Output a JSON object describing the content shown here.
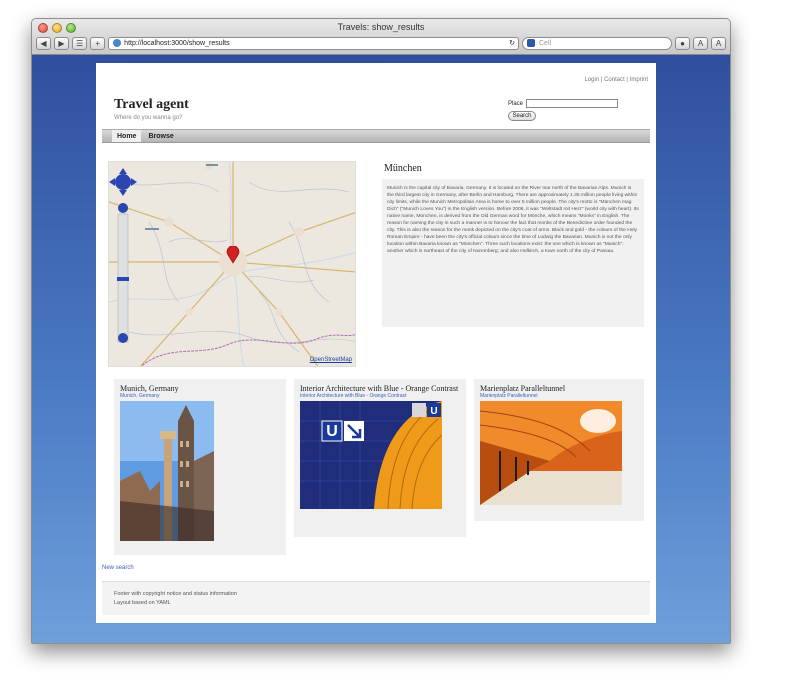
{
  "browser": {
    "window_title": "Travels: show_results",
    "url": "http://localhost:3000/show_results",
    "search_placeholder": "Cell",
    "text_buttons": [
      "A",
      "A"
    ]
  },
  "site": {
    "title": "Travel agent",
    "tagline": "Where do you wanna go?",
    "toplinks": {
      "login": "Login",
      "contact": "Contact",
      "imprint": "Imprint"
    },
    "place_label": "Place",
    "search_button": "Search",
    "nav": [
      {
        "label": "Home"
      },
      {
        "label": "Browse"
      }
    ]
  },
  "map": {
    "attribution": "OpenStreetMap",
    "marker_color": "#d22020"
  },
  "city": {
    "name": "München",
    "description": "Munich is the capital city of Bavaria, Germany. It is located on the River Isar north of the Bavarian Alps. Munich is the third largest city in Germany, after Berlin and Hamburg. There are approximately 1.35 million people living within city limits, while the Munich Metropolitan Area is home to over 5 million people. The city's motto is \"München mag Dich\" (\"Munich Loves You\") in the English version. Before 2006, it was \"Weltstadt mit Herz\" (world city with heart). Its native name, München, is derived from the Old German word for Mönche, which means \"Monks\" in English. The reason for naming the city in such a manner is to honour the fact that monks of the Benedictine order founded the city. This is also the reason for the monk depicted on the city's coat of arms. Black and gold - the colours of the Holy Roman Empire - have been the city's official colours since the time of Ludwig the Bavarian. Munich is not the only location within Bavaria known as \"München\". Three such locations exist: the one which is known as \"Munich\"; another which is northeast of the city of Nuremberg; and also Hofkirch, a town north of the city of Passau."
  },
  "photos": [
    {
      "title": "Munich, Germany",
      "link": "Munich, Germany"
    },
    {
      "title": "Interior Architecture with Blue - Orange Contrast",
      "link": "Interior Architecture with Blue - Orange Contrast"
    },
    {
      "title": "Marienplatz Paralleltunnel",
      "link": "Marienplatz Paralleltunnel"
    }
  ],
  "new_search": "New search",
  "footer": {
    "line1": "Footer with copyright notice and status information",
    "line2": "Layout based on YAML"
  }
}
